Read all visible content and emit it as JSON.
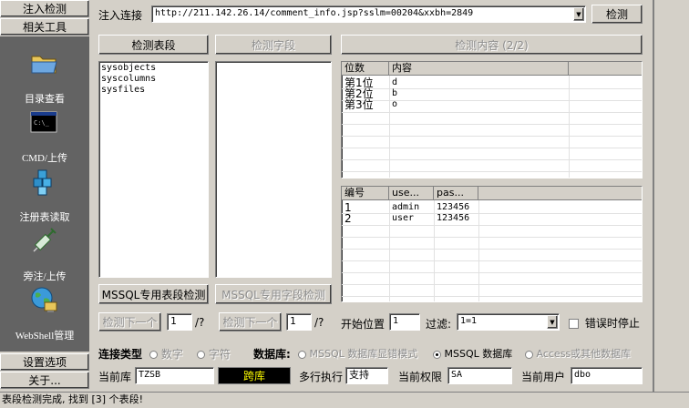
{
  "sidebar": {
    "tab_inject": "注入检测",
    "tab_tools": "相关工具",
    "tools": [
      {
        "label": "目录查看",
        "icon": "folder-icon"
      },
      {
        "label": "CMD/上传",
        "icon": "cmd-console-icon"
      },
      {
        "label": "注册表读取",
        "icon": "registry-cubes-icon"
      },
      {
        "label": "旁注/上传",
        "icon": "syringe-icon"
      },
      {
        "label": "WebShell管理",
        "icon": "globe-network-icon"
      }
    ],
    "tab_settings": "设置选项",
    "tab_about": "关于..."
  },
  "inject": {
    "label": "注入连接",
    "url": "http://211.142.26.14/comment_info.jsp?sslm=00204&xxbh=2849",
    "detect_button": "检测"
  },
  "buttons": {
    "detect_tables": "检测表段",
    "detect_fields": "检测字段",
    "detect_content": "检测内容 (2/2)",
    "mssql_table_detect": "MSSQL专用表段检测",
    "mssql_field_detect": "MSSQL专用字段检测",
    "next_a": "检测下一个",
    "next_b": "检测下一个"
  },
  "tables_list": [
    "sysobjects",
    "syscolumns",
    "sysfiles"
  ],
  "position_grid": {
    "headers": [
      "位数",
      "内容"
    ],
    "rows": [
      [
        "第1位",
        "d"
      ],
      [
        "第2位",
        "b"
      ],
      [
        "第3位",
        "o"
      ]
    ]
  },
  "result_grid": {
    "headers": [
      "编号",
      "use...",
      "pas..."
    ],
    "rows": [
      [
        "1",
        "admin",
        "123456"
      ],
      [
        "2",
        "user",
        "123456"
      ]
    ]
  },
  "paging": {
    "page_a": "1",
    "sep_a": "/?",
    "page_b": "1",
    "sep_b": "/?",
    "start_label": "开始位置",
    "start_value": "1",
    "filter_label": "过滤:",
    "filter_value": "1=1",
    "stop_on_error": "错误时停止"
  },
  "connection": {
    "type_label": "连接类型",
    "opt_numeric": "数字",
    "opt_string": "字符",
    "db_label": "数据库:",
    "opt_mssql_error": "MSSQL 数据库显错模式",
    "opt_mssql": "MSSQL 数据库",
    "opt_access": "Access或其他数据库"
  },
  "info": {
    "current_db_label": "当前库",
    "current_db": "TZSB",
    "cross_db": "跨库",
    "multi_exec_label": "多行执行",
    "multi_exec": "支持",
    "perm_label": "当前权限",
    "perm": "SA",
    "user_label": "当前用户",
    "user": "dbo"
  },
  "status": "表段检测完成, 找到 [3] 个表段!",
  "colors": {
    "sidebar_panel": "#636363",
    "face": "#d4d0c8",
    "cross_db_bg": "#000000",
    "cross_db_fg": "#ffff00"
  }
}
